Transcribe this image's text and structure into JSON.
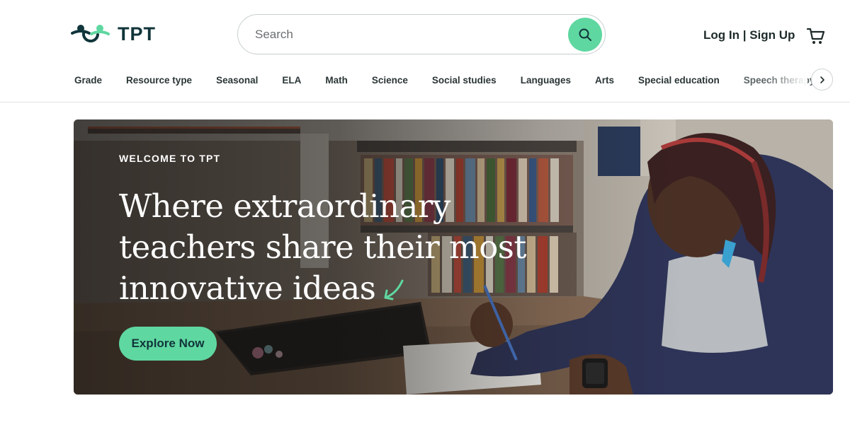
{
  "brand": {
    "logo_text": "TPT",
    "accent": "#5fd7a0",
    "dark": "#10353a"
  },
  "search": {
    "placeholder": "Search",
    "value": "",
    "button_icon": "search-icon"
  },
  "auth": {
    "login_label": "Log In",
    "separator": " | ",
    "signup_label": "Sign Up"
  },
  "cart": {
    "icon": "cart-icon"
  },
  "nav": {
    "items": [
      {
        "label": "Grade"
      },
      {
        "label": "Resource type"
      },
      {
        "label": "Seasonal"
      },
      {
        "label": "ELA"
      },
      {
        "label": "Math"
      },
      {
        "label": "Science"
      },
      {
        "label": "Social studies"
      },
      {
        "label": "Languages"
      },
      {
        "label": "Arts"
      },
      {
        "label": "Special education"
      },
      {
        "label": "Speech therapy"
      }
    ],
    "next_icon": "chevron-right-icon"
  },
  "hero": {
    "eyebrow": "WELCOME TO TPT",
    "headline_line1": "Where extraordinary",
    "headline_line2": "teachers share their most",
    "headline_line3": "innovative ideas",
    "cta_label": "Explore Now",
    "image": "teacher-writing-photo"
  }
}
